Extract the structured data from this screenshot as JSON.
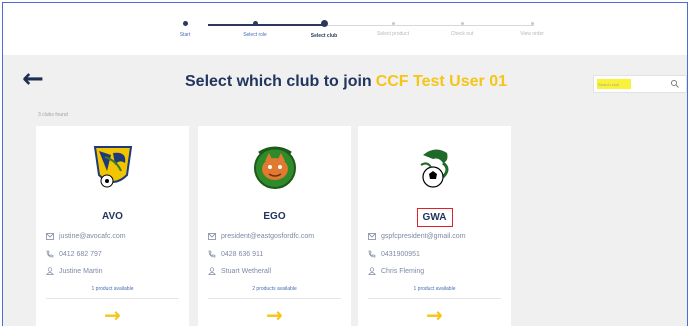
{
  "stepper": {
    "steps": [
      {
        "label": "Start",
        "state": "done"
      },
      {
        "label": "Select role",
        "state": "done"
      },
      {
        "label": "Select club",
        "state": "current"
      },
      {
        "label": "Select product",
        "state": "todo"
      },
      {
        "label": "Check out",
        "state": "todo"
      },
      {
        "label": "View order",
        "state": "todo"
      }
    ]
  },
  "header": {
    "title": "Select which club to join",
    "user_name": "CCF Test User 01",
    "back_icon": "arrow-left-icon"
  },
  "search": {
    "placeholder": "Search club",
    "icon": "search-icon"
  },
  "results": {
    "count_text": "3 clubs found"
  },
  "colors": {
    "accent": "#f5c518",
    "primary": "#22355e",
    "link": "#4b6cb7",
    "highlight": "#f8f23a",
    "annotation": "#e0212c"
  },
  "clubs": [
    {
      "name": "AVO",
      "email": "justine@avocafc.com",
      "phone": "0412 682 797",
      "contact": "Justine Martin",
      "products": "1 product available",
      "logo_icon": "avoca-fc-crest-icon"
    },
    {
      "name": "EGO",
      "email": "president@eastgosfordfc.com",
      "phone": "0428 636 911",
      "contact": "Stuart Wetherall",
      "products": "2 products available",
      "logo_icon": "east-gosford-fc-crest-icon"
    },
    {
      "name": "GWA",
      "email": "gspfcpresident@gmail.com",
      "phone": "0431900951",
      "contact": "Chris Fleming",
      "products": "1 product available",
      "logo_icon": "gwandalan-fc-crest-icon"
    }
  ]
}
